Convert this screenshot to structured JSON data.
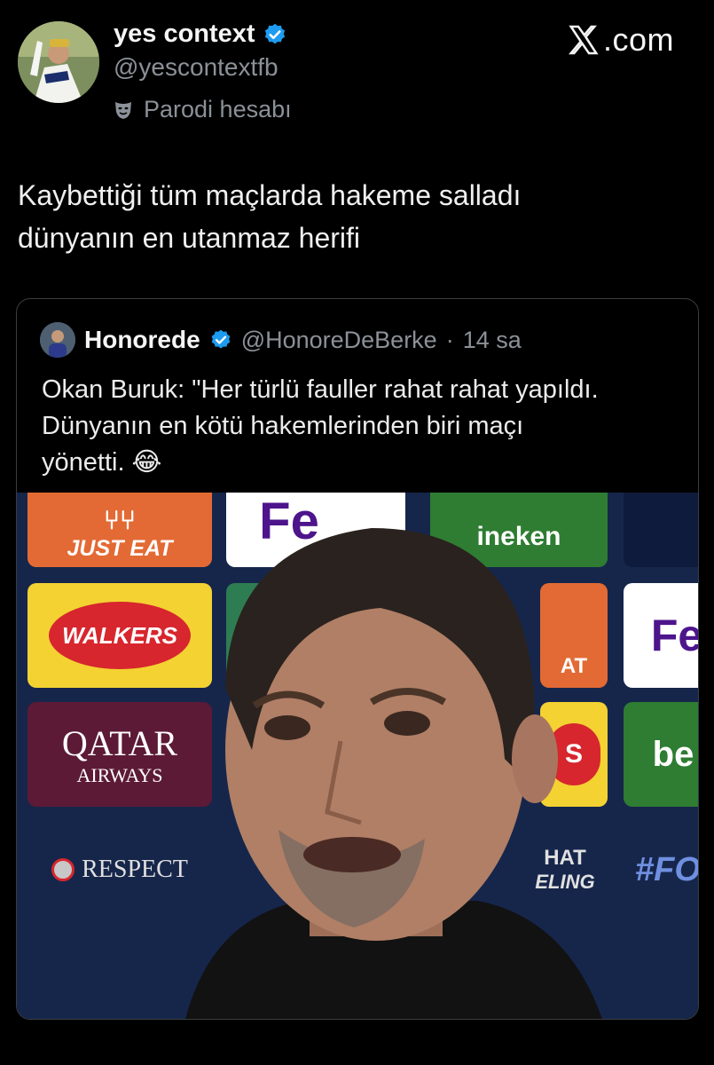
{
  "author": {
    "name": "yes context",
    "handle": "@yescontextfb",
    "parody_label": "Parodi hesabı",
    "verified": true,
    "avatar_icon": "avatar-photo"
  },
  "brand": {
    "logo_icon": "x-logo-icon",
    "text": ".com"
  },
  "tweet": {
    "text": "Kaybettiği tüm maçlarda hakeme salladı\ndünyanın en utanmaz herifi"
  },
  "quoted": {
    "name": "Honorede",
    "handle": "@HonoreDeBerke",
    "separator": "·",
    "time": "14 sa",
    "text": "Okan Buruk: \"Her türlü fauller rahat rahat yapıldı.\nDünyanın en kötü hakemlerinden biri maçı\nyönetti. 😂",
    "media": {
      "boards": {
        "justeat": "JUST EAT",
        "walkers": "WALKERS",
        "qatar": "QATAR",
        "airways": "AIRWAYS",
        "respect": "RESPECT",
        "heineken": "ineken",
        "fedex_top": "Fe",
        "fedex_right": "Fe",
        "bet": "be",
        "hashtag": "#FO",
        "hat": "HAT",
        "eling": "ELING",
        "at": "AT",
        "s": "S"
      }
    }
  },
  "colors": {
    "background": "#000000",
    "verified_blue": "#1d9bf0",
    "secondary_text": "#8b9198",
    "board_blue": "#16264b"
  }
}
